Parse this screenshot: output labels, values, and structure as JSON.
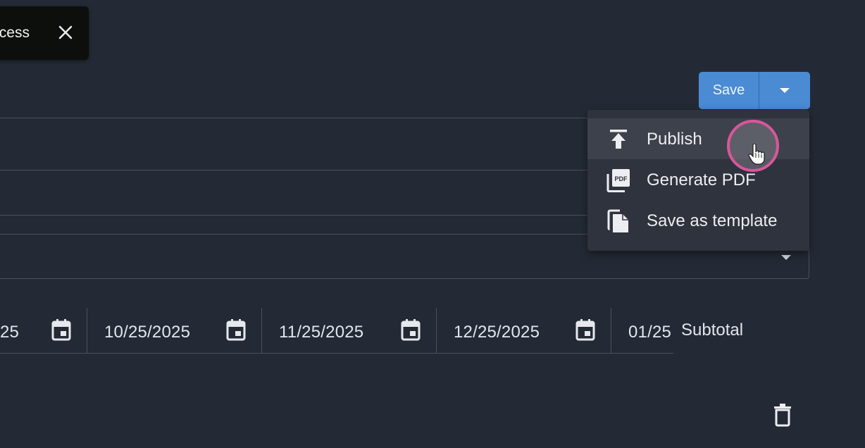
{
  "toast": {
    "message": "Success",
    "close_icon": "close-icon"
  },
  "toolbar": {
    "save_label": "Save",
    "toggle_icon": "caret-down-icon"
  },
  "save_menu": {
    "items": [
      {
        "label": "Publish",
        "icon": "publish-icon"
      },
      {
        "label": "Generate PDF",
        "icon": "pdf-icon"
      },
      {
        "label": "Save as template",
        "icon": "copy-icon"
      }
    ]
  },
  "dates": {
    "cells": [
      "25",
      "10/25/2025",
      "11/25/2025",
      "12/25/2025",
      "01/25"
    ],
    "icon": "calendar-icon"
  },
  "subtotal_label": "Subtotal",
  "colors": {
    "background": "#242a35",
    "accent": "#4a8bd4",
    "menu_bg": "#2e333d",
    "menu_hover": "#3c414b",
    "cursor_ring": "#d9569b"
  }
}
